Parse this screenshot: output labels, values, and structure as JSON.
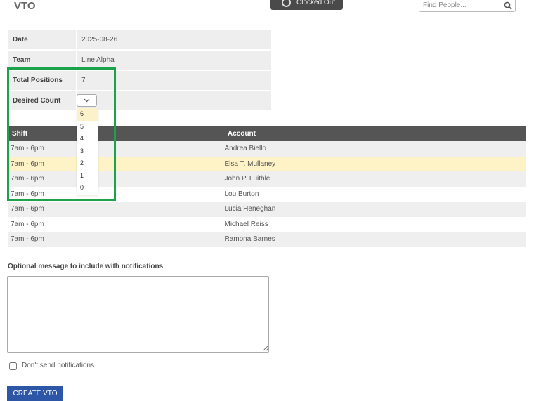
{
  "header": {
    "title": "VTO",
    "clock_status": "Clocked Out",
    "search_placeholder": "Find People..."
  },
  "info": {
    "date_label": "Date",
    "date_value": "2025-08-26",
    "team_label": "Team",
    "team_value": "Line Alpha",
    "total_label": "Total Positions",
    "total_value": "7",
    "desired_label": "Desired Count"
  },
  "desired_dropdown": {
    "selected": "6",
    "options": [
      "6",
      "5",
      "4",
      "3",
      "2",
      "1",
      "0"
    ]
  },
  "shifts_table": {
    "columns": [
      "Shift",
      "Account"
    ],
    "rows": [
      [
        "7am - 6pm",
        "Andrea Biello"
      ],
      [
        "7am - 6pm",
        "Elsa T. Mullaney"
      ],
      [
        "7am - 6pm",
        "John P. Luithle"
      ],
      [
        "7am - 6pm",
        "Lou Burton"
      ],
      [
        "7am - 6pm",
        "Lucia Heneghan"
      ],
      [
        "7am - 6pm",
        "Michael Reiss"
      ],
      [
        "7am - 6pm",
        "Ramona Barnes"
      ]
    ]
  },
  "message": {
    "label": "Optional message to include with notifications",
    "value": ""
  },
  "notify_checkbox": {
    "label": "Don't send notifications",
    "checked": false
  },
  "create_button": "CREATE VTO",
  "colors": {
    "highlight_border": "#1aa34a",
    "header_row": "#555555",
    "row_highlight": "#fdf3c6",
    "primary_button": "#2d57a6"
  }
}
